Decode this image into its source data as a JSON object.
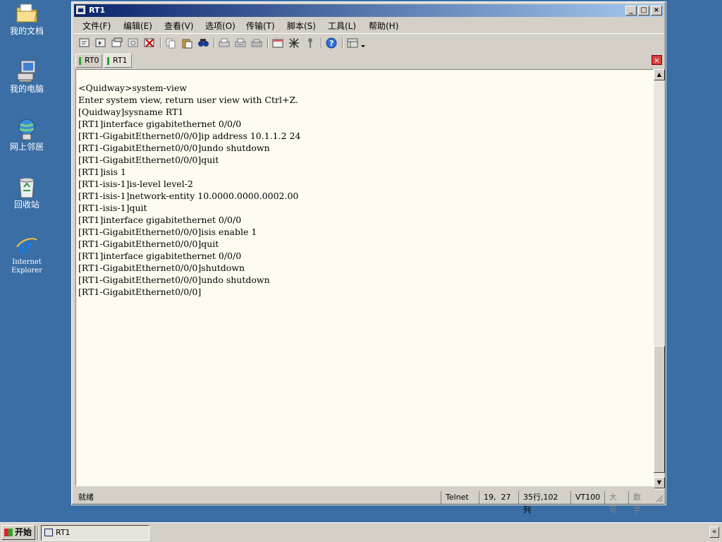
{
  "desktop": {
    "icons": [
      {
        "label": "我的文档",
        "icon": "my-documents-icon"
      },
      {
        "label": "我的电脑",
        "icon": "my-computer-icon"
      },
      {
        "label": "网上邻居",
        "icon": "network-places-icon"
      },
      {
        "label": "回收站",
        "icon": "recycle-bin-icon"
      },
      {
        "label": "Internet Explorer",
        "icon": "internet-explorer-icon"
      }
    ]
  },
  "window": {
    "title": "RT1",
    "controls": {
      "minimize": "_",
      "maximize": "□",
      "close": "×"
    },
    "menu": [
      "文件(F)",
      "编辑(E)",
      "查看(V)",
      "选项(O)",
      "传输(T)",
      "脚本(S)",
      "工具(L)",
      "帮助(H)"
    ],
    "toolbar_icons": [
      "connect-icon",
      "quick-connect-icon",
      "connect-tab-icon",
      "reconnect-icon",
      "disconnect-icon",
      "copy-icon",
      "paste-icon",
      "find-icon",
      "print-icon",
      "print-setup-icon",
      "print-selection-icon",
      "session-options-icon",
      "global-options-icon",
      "keymap-icon",
      "help-icon",
      "tile-icon",
      "more-icon"
    ],
    "tabs": [
      {
        "label": "RT0",
        "active": false
      },
      {
        "label": "RT1",
        "active": true
      }
    ],
    "tab_close": "×",
    "terminal_lines": [
      "<Quidway>system-view",
      "Enter system view, return user view with Ctrl+Z.",
      "[Quidway]sysname RT1",
      "[RT1]interface gigabitethernet 0/0/0",
      "[RT1-GigabitEthernet0/0/0]ip address 10.1.1.2 24",
      "[RT1-GigabitEthernet0/0/0]undo shutdown",
      "[RT1-GigabitEthernet0/0/0]quit",
      "[RT1]isis 1",
      "[RT1-isis-1]is-level level-2",
      "[RT1-isis-1]network-entity 10.0000.0000.0002.00",
      "[RT1-isis-1]quit",
      "[RT1]interface gigabitethernet 0/0/0",
      "[RT1-GigabitEthernet0/0/0]isis enable 1",
      "[RT1-GigabitEthernet0/0/0]quit",
      "[RT1]interface gigabitethernet 0/0/0",
      "[RT1-GigabitEthernet0/0/0]shutdown",
      "[RT1-GigabitEthernet0/0/0]undo shutdown",
      "[RT1-GigabitEthernet0/0/0]"
    ],
    "scroll_up": "▲",
    "scroll_down": "▼",
    "status": {
      "ready": "就绪",
      "protocol": "Telnet",
      "cursor": "19,  27",
      "size": "35行,102列",
      "emulation": "VT100",
      "caps": "大写",
      "num": "数字"
    }
  },
  "taskbar": {
    "start_label": "开始",
    "items": [
      {
        "label": "RT1"
      }
    ],
    "tray_toggle": "«"
  }
}
